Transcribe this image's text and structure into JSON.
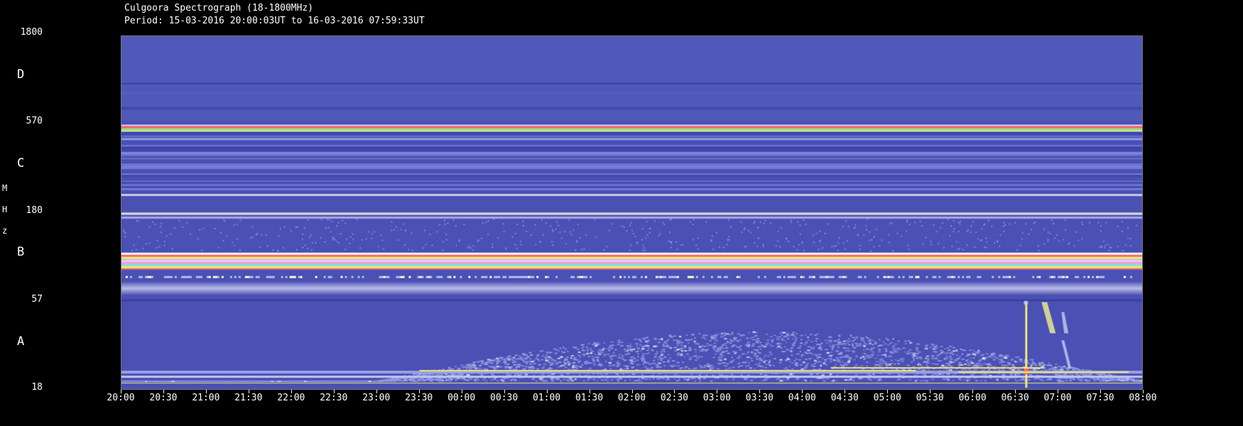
{
  "chart_data": {
    "type": "heatmap",
    "title": "Culgoora Spectrograph (18-1800MHz)",
    "subtitle": "Period: 15-03-2016 20:00:03UT to 16-03-2016 07:59:33UT",
    "ylabel": [
      "M",
      "H",
      "z"
    ],
    "y_ticks": [
      "1800",
      "570",
      "180",
      "57",
      "18"
    ],
    "bands": [
      "D",
      "C",
      "B",
      "A"
    ],
    "x_ticks": [
      "20:00",
      "20:30",
      "21:00",
      "21:30",
      "22:00",
      "22:30",
      "23:00",
      "23:30",
      "00:00",
      "00:30",
      "01:00",
      "01:30",
      "02:00",
      "02:30",
      "03:00",
      "03:30",
      "04:00",
      "04:30",
      "05:00",
      "05:30",
      "06:00",
      "06:30",
      "07:00",
      "07:30",
      "08:00"
    ],
    "xlim": [
      "20:00",
      "08:00"
    ],
    "ylim_mhz": [
      18,
      1800
    ],
    "y_scale": "log",
    "features": [
      {
        "kind": "burst",
        "time": "06:38",
        "freq_range_mhz": [
          18,
          60
        ]
      },
      {
        "kind": "drifting burst",
        "time": "06:48",
        "freq_range_mhz": [
          35,
          60
        ]
      }
    ],
    "colors": {
      "background": "#4a50b4",
      "low": "#5a62c8",
      "mid": "#c8c8f0",
      "high": "#f8f070",
      "peak": "#f06060"
    }
  }
}
